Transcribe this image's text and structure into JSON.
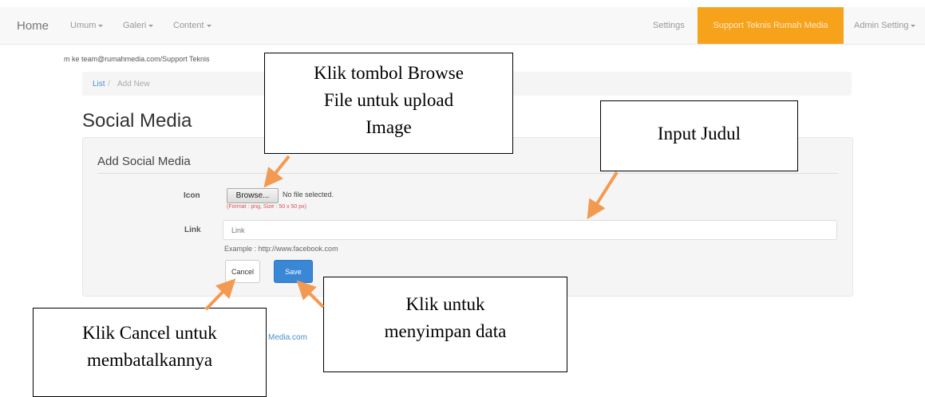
{
  "navbar": {
    "brand": "Home",
    "menus": [
      "Umum",
      "Galeri",
      "Content"
    ],
    "settings": "Settings",
    "support": "Support Teknis Rumah Media",
    "admin": "Admin Setting"
  },
  "info_line": "m ke team@rumahmedia.com/Support Teknis",
  "breadcrumb": {
    "list": "List",
    "separator": "/",
    "add_new": "Add New"
  },
  "page_title": "Social Media",
  "form": {
    "title": "Add Social Media",
    "icon_label": "Icon",
    "browse_label": "Browse...",
    "no_file_text": "No file selected.",
    "format_hint": "(Format : png, Size : 50 x 50 px)",
    "link_label": "Link",
    "link_placeholder": "Link",
    "link_value": "",
    "example_text": "Example : http://www.facebook.com",
    "cancel_label": "Cancel",
    "save_label": "Save"
  },
  "footer_text": "Media.com",
  "callouts": {
    "browse": [
      "Klik tombol Browse",
      "File untuk upload",
      "Image"
    ],
    "judul": [
      "Input Judul"
    ],
    "save": [
      "Klik untuk",
      "menyimpan data"
    ],
    "cancel": [
      "Klik Cancel untuk",
      "membatalkannya"
    ]
  },
  "colors": {
    "accent_orange": "#f7a21b",
    "arrow_orange": "#f39a52",
    "primary_blue": "#3a87d6",
    "link_blue": "#4a90c9",
    "error_red": "#d9534f"
  }
}
